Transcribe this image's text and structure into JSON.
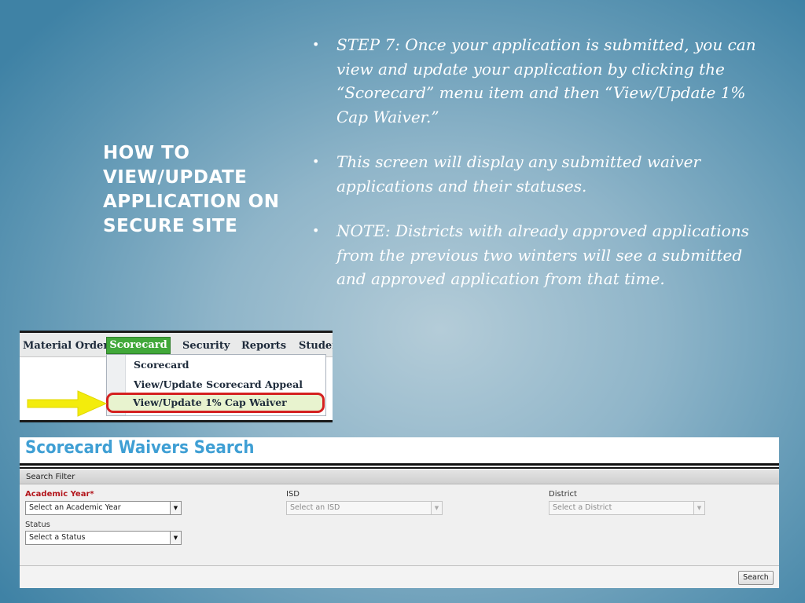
{
  "slide": {
    "title": "HOW TO VIEW/UPDATE APPLICATION ON SECURE SITE",
    "bullets": [
      "STEP 7: Once your application is submitted, you can view and update your application by clicking the “Scorecard” menu item and then “View/Update 1% Cap Waiver.”",
      "This screen will display any submitted waiver applications and their statuses.",
      "NOTE:  Districts with already approved applications from the previous two winters will see a submitted and approved application from that time."
    ],
    "bullet_glyph": "•"
  },
  "menu_screenshot": {
    "menu_items": [
      "Material Orders",
      "Scorecard",
      "Security",
      "Reports",
      "Studen"
    ],
    "active_item": "Scorecard",
    "dropdown_items": [
      "Scorecard",
      "View/Update Scorecard Appeal",
      "View/Update 1% Cap Waiver"
    ],
    "highlighted_item": "View/Update 1% Cap Waiver",
    "active_color": "#41a83a",
    "highlight_border_color": "#d42020",
    "arrow_color": "#f3ec0c",
    "arrow_icon": "arrow-right-icon"
  },
  "search_panel": {
    "title": "Scorecard Waivers Search",
    "title_color": "#3f9fd4",
    "filter_label": "Search Filter",
    "fields": {
      "academic_year": {
        "label": "Academic Year*",
        "value": "Select an Academic Year",
        "required": true
      },
      "isd": {
        "label": "ISD",
        "value": "Select an ISD",
        "disabled": true
      },
      "district": {
        "label": "District",
        "value": "Select a District",
        "disabled": true
      },
      "status": {
        "label": "Status",
        "value": "Select a Status"
      }
    },
    "dropdown_icon": "triangle-down-icon",
    "search_button": "Search"
  }
}
